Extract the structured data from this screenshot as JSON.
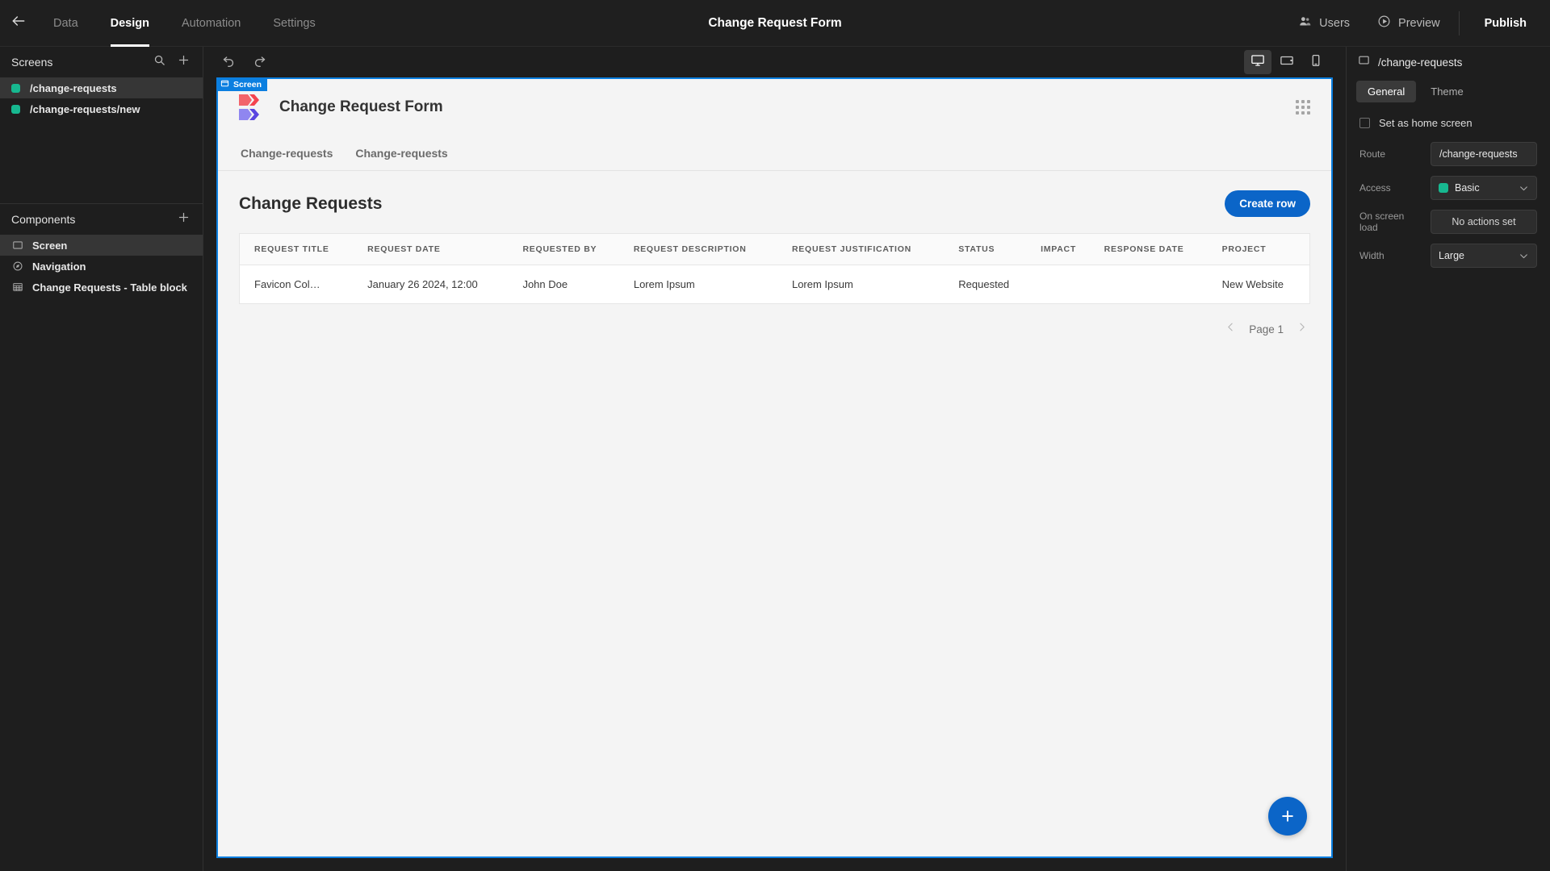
{
  "topbar": {
    "back_icon": "arrow-left-icon",
    "tabs": [
      {
        "label": "Data",
        "active": false
      },
      {
        "label": "Design",
        "active": true
      },
      {
        "label": "Automation",
        "active": false
      },
      {
        "label": "Settings",
        "active": false
      }
    ],
    "title": "Change Request Form",
    "users_label": "Users",
    "preview_label": "Preview",
    "publish_label": "Publish"
  },
  "left_panel": {
    "screens_title": "Screens",
    "search_icon": "search-icon",
    "add_icon": "plus-icon",
    "screens": [
      {
        "label": "/change-requests",
        "selected": true,
        "color": "#17b890"
      },
      {
        "label": "/change-requests/new",
        "selected": false,
        "color": "#17b890"
      }
    ],
    "components_title": "Components",
    "components_add_icon": "plus-icon",
    "components": [
      {
        "label": "Screen",
        "icon": "screen-icon",
        "selected": true
      },
      {
        "label": "Navigation",
        "icon": "navigation-icon",
        "selected": false
      },
      {
        "label": "Change Requests - Table block",
        "icon": "table-icon",
        "selected": false
      }
    ]
  },
  "canvas_toolbar": {
    "undo_icon": "undo-icon",
    "redo_icon": "redo-icon",
    "devices": [
      {
        "name": "desktop",
        "active": true
      },
      {
        "name": "tablet",
        "active": false
      },
      {
        "name": "mobile",
        "active": false
      }
    ]
  },
  "canvas": {
    "badge_label": "Screen",
    "app_title": "Change Request Form",
    "nav_items": [
      "Change-requests",
      "Change-requests"
    ],
    "main_title": "Change Requests",
    "create_row_label": "Create row",
    "columns": [
      "REQUEST TITLE",
      "REQUEST DATE",
      "REQUESTED BY",
      "REQUEST DESCRIPTION",
      "REQUEST JUSTIFICATION",
      "STATUS",
      "IMPACT",
      "RESPONSE DATE",
      "PROJECT"
    ],
    "rows": [
      {
        "request_title": "Favicon Col…",
        "request_date": "January 26 2024, 12:00",
        "requested_by": "John Doe",
        "request_description": "Lorem Ipsum",
        "request_justification": "Lorem Ipsum",
        "status": "Requested",
        "impact": "",
        "response_date": "",
        "project": "New Website"
      }
    ],
    "page_label": "Page 1",
    "fab_label": "+",
    "accent_color": "#0b65c8"
  },
  "right_panel": {
    "header_title": "/change-requests",
    "header_icon": "screen-icon",
    "tabs": [
      {
        "label": "General",
        "active": true
      },
      {
        "label": "Theme",
        "active": false
      }
    ],
    "home_screen_label": "Set as home screen",
    "home_screen_checked": false,
    "route_label": "Route",
    "route_value": "/change-requests",
    "access_label": "Access",
    "access_value": "Basic",
    "access_color": "#17b890",
    "on_screen_load_label": "On screen load",
    "on_screen_load_value": "No actions set",
    "width_label": "Width",
    "width_value": "Large"
  }
}
